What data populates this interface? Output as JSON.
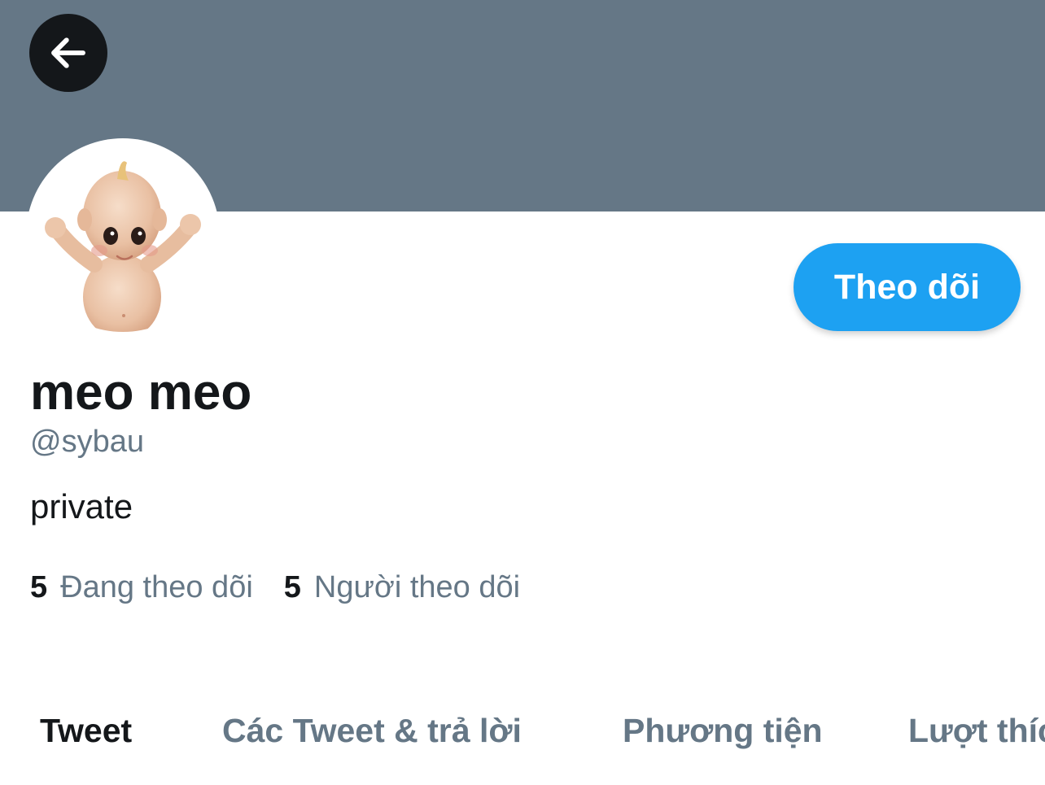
{
  "colors": {
    "banner": "#657786",
    "accent": "#1da1f2",
    "text_primary": "#14171a",
    "text_secondary": "#657786"
  },
  "header": {
    "back_icon": "arrow-left-icon"
  },
  "profile": {
    "avatar_icon": "kewpie-doll-avatar",
    "follow_label": "Theo dõi",
    "display_name": "meo meo",
    "handle": "@sybau",
    "bio": "private",
    "following_count": "5",
    "following_label": "Đang theo dõi",
    "followers_count": "5",
    "followers_label": "Người theo dõi"
  },
  "tabs": [
    {
      "label": "Tweet",
      "active": true
    },
    {
      "label": "Các Tweet & trả lời",
      "active": false
    },
    {
      "label": "Phương tiện",
      "active": false
    },
    {
      "label": "Lượt thích",
      "active": false
    }
  ]
}
